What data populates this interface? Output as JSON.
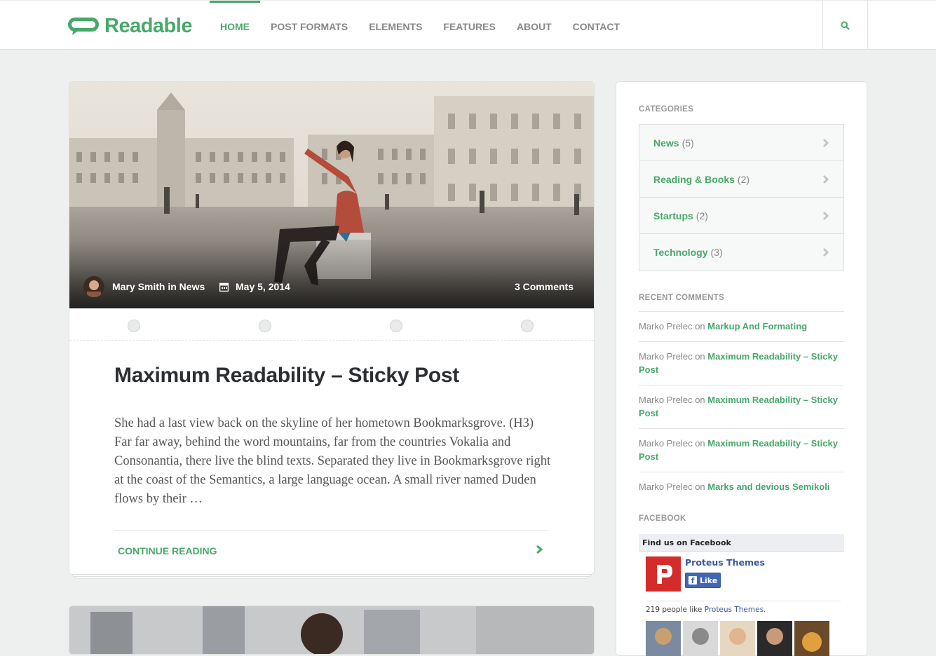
{
  "header": {
    "logo_text": "Readable",
    "nav": [
      "HOME",
      "POST FORMATS",
      "ELEMENTS",
      "FEATURES",
      "ABOUT",
      "CONTACT"
    ],
    "active_nav": "HOME"
  },
  "post": {
    "author": "Mary Smith in News",
    "date": "May 5, 2014",
    "comments": "3 Comments",
    "title": "Maximum Readability – Sticky Post",
    "excerpt": "She had a last view back on the skyline of her hometown Bookmarksgrove. (H3) Far far away, behind the word mountains, far from the countries Vokalia and Consonantia, there live the blind texts. Separated they live in Bookmarksgrove right at the coast of the Semantics, a large language ocean. A small river named Duden flows by their …",
    "continue_label": "CONTINUE READING"
  },
  "sidebar": {
    "categories_title": "CATEGORIES",
    "categories": [
      {
        "name": "News",
        "count": "(5)"
      },
      {
        "name": "Reading & Books",
        "count": "(2)"
      },
      {
        "name": "Startups",
        "count": "(2)"
      },
      {
        "name": "Technology",
        "count": "(3)"
      }
    ],
    "recent_title": "RECENT COMMENTS",
    "recent": [
      {
        "author": "Marko Prelec",
        "on": "on",
        "post": "Markup And Formating"
      },
      {
        "author": "Marko Prelec",
        "on": "on",
        "post": "Maximum Readability – Sticky Post"
      },
      {
        "author": "Marko Prelec",
        "on": "on",
        "post": "Maximum Readability – Sticky Post"
      },
      {
        "author": "Marko Prelec",
        "on": "on",
        "post": "Maximum Readability – Sticky Post"
      },
      {
        "author": "Marko Prelec",
        "on": "on",
        "post": "Marks and devious Semikoli"
      }
    ],
    "facebook_title": "FACEBOOK",
    "fb": {
      "header": "Find us on Facebook",
      "page_name": "Proteus Themes",
      "like_label": "Like",
      "count_prefix": "219 people like",
      "count_link": "Proteus Themes",
      "count_suffix": "."
    }
  },
  "colors": {
    "accent": "#48a86a",
    "background": "#eef0ef",
    "facebook": "#3b5998"
  }
}
